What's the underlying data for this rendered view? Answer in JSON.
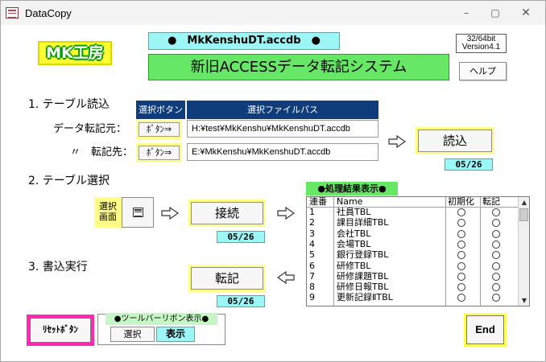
{
  "window": {
    "title": "DataCopy",
    "minimize_glyph": "–",
    "maximize_glyph": "▢",
    "close_glyph": "✕"
  },
  "header": {
    "logo_text": "MK工房",
    "db_name": "●　MkKenshuDT.accdb　●",
    "system_name": "新旧ACCESSデータ転記システム",
    "version_line1": "32/64bit",
    "version_line2": "Version4.1",
    "help_label": "ヘルプ"
  },
  "section1": {
    "title": "1. テーブル読込",
    "col_select": "選択ボタン",
    "col_path": "選択ファイルパス",
    "source_label": "データ転記元：",
    "dest_label": "〃　転記先：",
    "source_button": "ﾎﾞﾀﾝ⇒",
    "dest_button": "ﾎﾞﾀﾝ⇒",
    "source_path": "H:¥test¥MkKenshu¥MkKenshuDT.accdb",
    "dest_path": "E:¥MkKenshu¥MkKenshuDT.accdb",
    "read_button": "読込",
    "read_date": "05/26"
  },
  "section2": {
    "title": "2. テーブル選択",
    "screen_label": "選択\n画面",
    "connect_button": "接続",
    "connect_date": "05/26"
  },
  "section3": {
    "title": "3. 書込実行",
    "transfer_button": "転記",
    "transfer_date": "05/26"
  },
  "results": {
    "title": "●処理結果表示●",
    "columns": [
      "連番",
      "Name",
      "初期化",
      "転記"
    ],
    "rows": [
      {
        "no": "1",
        "name": "社員TBL"
      },
      {
        "no": "2",
        "name": "課目詳細TBL"
      },
      {
        "no": "3",
        "name": "会社TBL"
      },
      {
        "no": "4",
        "name": "会場TBL"
      },
      {
        "no": "5",
        "name": "銀行登録TBL"
      },
      {
        "no": "6",
        "name": "研修TBL"
      },
      {
        "no": "7",
        "name": "研修課題TBL"
      },
      {
        "no": "8",
        "name": "研修日報TBL"
      },
      {
        "no": "9",
        "name": "更新記録ⅡTBL"
      }
    ]
  },
  "footer": {
    "reset_button": "ﾘｾｯﾄﾎﾞﾀﾝ",
    "ribbon_title": "●ツールバーリボン表示●",
    "ribbon_select": "選択",
    "ribbon_show": "表示",
    "end_button": "End"
  },
  "colors": {
    "header_blue": "#0f3c7a",
    "cyan": "#9cf6f6",
    "green": "#66e866",
    "yellow": "#ffff88",
    "pink": "#ff2ab0"
  }
}
